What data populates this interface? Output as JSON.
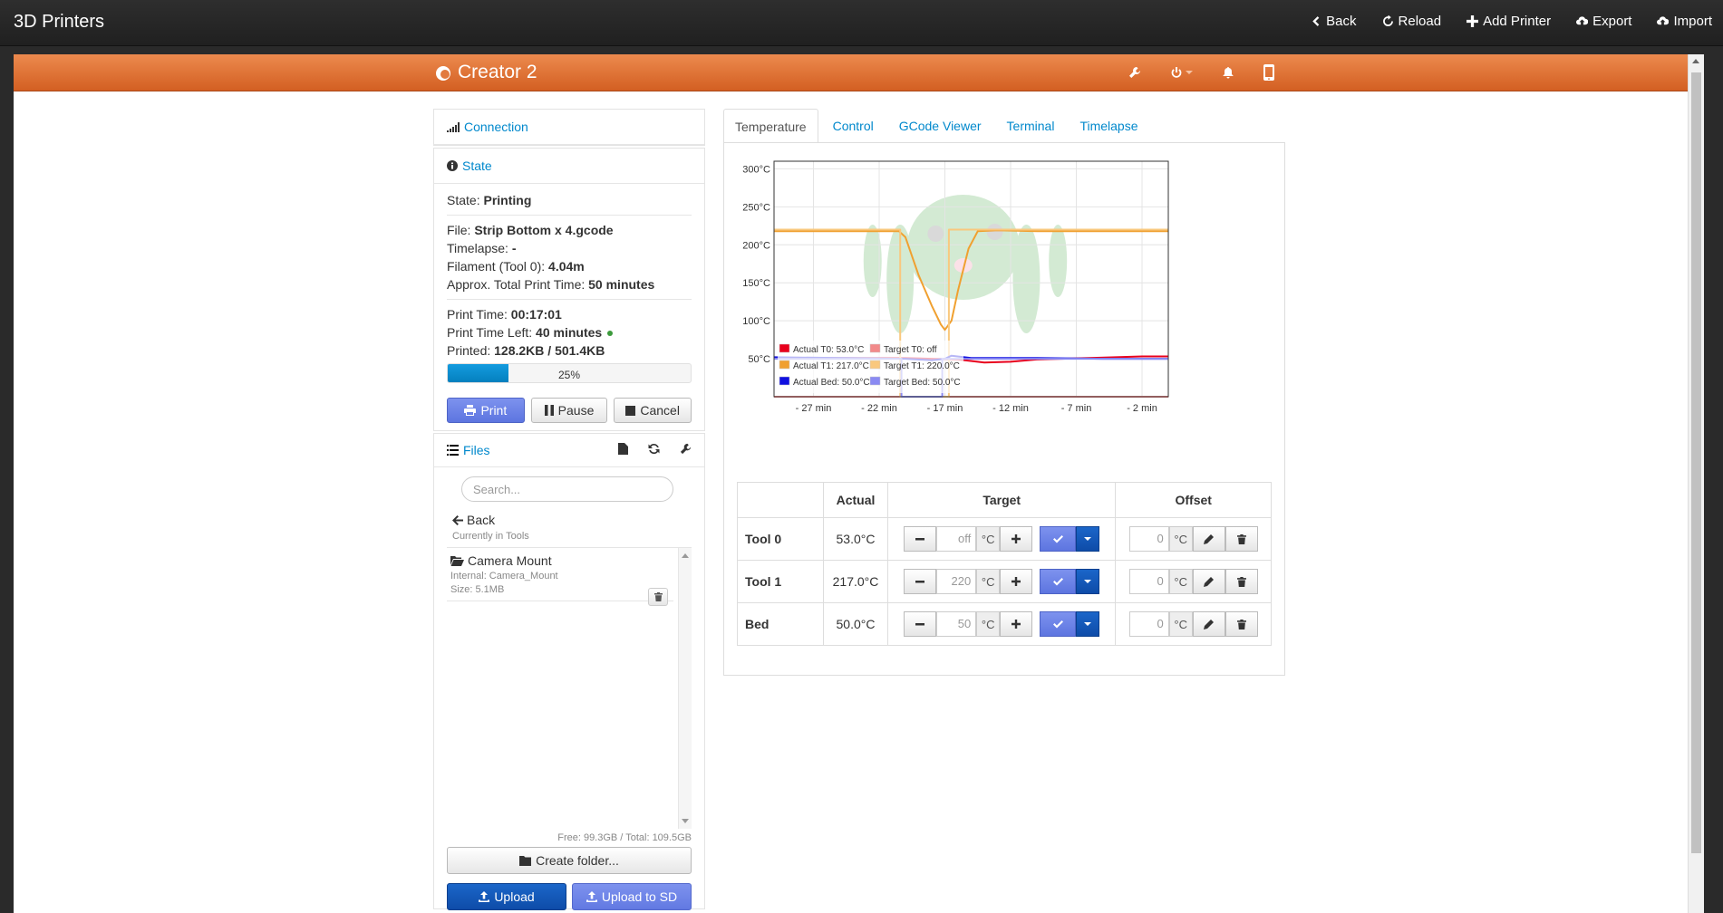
{
  "topbar": {
    "title": "3D Printers",
    "nav": [
      {
        "label": "Back",
        "icon": "chevron-left-icon"
      },
      {
        "label": "Reload",
        "icon": "refresh-icon"
      },
      {
        "label": "Add Printer",
        "icon": "plus-icon"
      },
      {
        "label": "Export",
        "icon": "cloud-download-icon"
      },
      {
        "label": "Import",
        "icon": "cloud-upload-icon"
      }
    ]
  },
  "printer": {
    "name": "Creator 2",
    "toolbar_icons": [
      "wrench-icon",
      "power-icon",
      "bell-icon",
      "mobile-icon"
    ]
  },
  "connection": {
    "label": "Connection"
  },
  "state": {
    "header": "State",
    "state_label": "State:",
    "state_value": "Printing",
    "file_label": "File:",
    "file_value": "Strip Bottom x 4.gcode",
    "timelapse_label": "Timelapse:",
    "timelapse_value": "-",
    "filament_label": "Filament (Tool 0):",
    "filament_value": "4.04m",
    "approx_label": "Approx. Total Print Time:",
    "approx_value": "50 minutes",
    "print_time_label": "Print Time:",
    "print_time_value": "00:17:01",
    "time_left_label": "Print Time Left:",
    "time_left_value": "40 minutes",
    "printed_label": "Printed:",
    "printed_value": "128.2KB / 501.4KB",
    "progress": 0.25,
    "progress_label": "25%",
    "buttons": {
      "print": "Print",
      "pause": "Pause",
      "cancel": "Cancel"
    }
  },
  "files": {
    "header": "Files",
    "search_placeholder": "Search...",
    "back": "Back",
    "currently_in": "Currently in Tools",
    "items": [
      {
        "name": "Camera Mount",
        "internal": "Internal: Camera_Mount",
        "size": "Size: 5.1MB"
      }
    ],
    "freespace": "Free: 99.3GB / Total: 109.5GB",
    "create_folder": "Create folder...",
    "upload": "Upload",
    "upload_sd": "Upload to SD"
  },
  "tabs": [
    "Temperature",
    "Control",
    "GCode Viewer",
    "Terminal",
    "Timelapse"
  ],
  "chart_data": {
    "type": "line",
    "title": "",
    "xlabel": "",
    "ylabel": "",
    "xlim": [
      -30,
      0
    ],
    "ylim": [
      0,
      310
    ],
    "x_ticks": [
      "- 27 min",
      "- 22 min",
      "- 17 min",
      "- 12 min",
      "- 7 min",
      "- 2 min"
    ],
    "x_tick_values": [
      -27,
      -22,
      -17,
      -12,
      -7,
      -2
    ],
    "y_ticks": [
      "50°C",
      "100°C",
      "150°C",
      "200°C",
      "250°C",
      "300°C"
    ],
    "y_tick_values": [
      50,
      100,
      150,
      200,
      250,
      300
    ],
    "series": [
      {
        "name": "Actual T0: 53.0°C",
        "color": "#e8001c",
        "x": [
          -30,
          -25,
          -20,
          -18,
          -16,
          -14,
          -12,
          -10,
          -6,
          -2,
          0
        ],
        "y": [
          51,
          51,
          51,
          50,
          49,
          45,
          46,
          49,
          51,
          53,
          53
        ]
      },
      {
        "name": "Target T0: off",
        "color": "#f28a8a",
        "x": [
          -30,
          0
        ],
        "y": [
          0,
          0
        ]
      },
      {
        "name": "Actual T1: 217.0°C",
        "color": "#f0a030",
        "x": [
          -30,
          -20.5,
          -20,
          -19,
          -18,
          -17.3,
          -17,
          -16.5,
          -16,
          -15.2,
          -14.5,
          -13,
          -10,
          -5,
          0
        ],
        "y": [
          218,
          218,
          210,
          160,
          120,
          95,
          88,
          100,
          140,
          195,
          218,
          219,
          218,
          218,
          218
        ]
      },
      {
        "name": "Target T1: 220.0°C",
        "color": "#f9c87e",
        "x": [
          -30,
          -20.4,
          -20.4,
          -16.7,
          -16.7,
          0
        ],
        "y": [
          220,
          220,
          0,
          0,
          220,
          220
        ]
      },
      {
        "name": "Actual Bed: 50.0°C",
        "color": "#1010e0",
        "x": [
          -30,
          -20,
          -18,
          -17,
          -16.5,
          -15,
          -10,
          -5,
          0
        ],
        "y": [
          52,
          50,
          48,
          50,
          54,
          51,
          51,
          50,
          50
        ]
      },
      {
        "name": "Target Bed: 50.0°C",
        "color": "#8a8af2",
        "x": [
          -30,
          -20.3,
          -20.3,
          -17.2,
          -17.2,
          0
        ],
        "y": [
          50,
          50,
          0,
          0,
          50,
          50
        ]
      }
    ],
    "legend": "bottom-left"
  },
  "temps_table": {
    "headers": [
      "",
      "Actual",
      "Target",
      "Offset"
    ],
    "rows": [
      {
        "name": "Tool 0",
        "actual": "53.0°C",
        "target": "off",
        "offset": "0"
      },
      {
        "name": "Tool 1",
        "actual": "217.0°C",
        "target": "220",
        "offset": "0"
      },
      {
        "name": "Bed",
        "actual": "50.0°C",
        "target": "50",
        "offset": "0"
      }
    ],
    "unit": "°C"
  }
}
